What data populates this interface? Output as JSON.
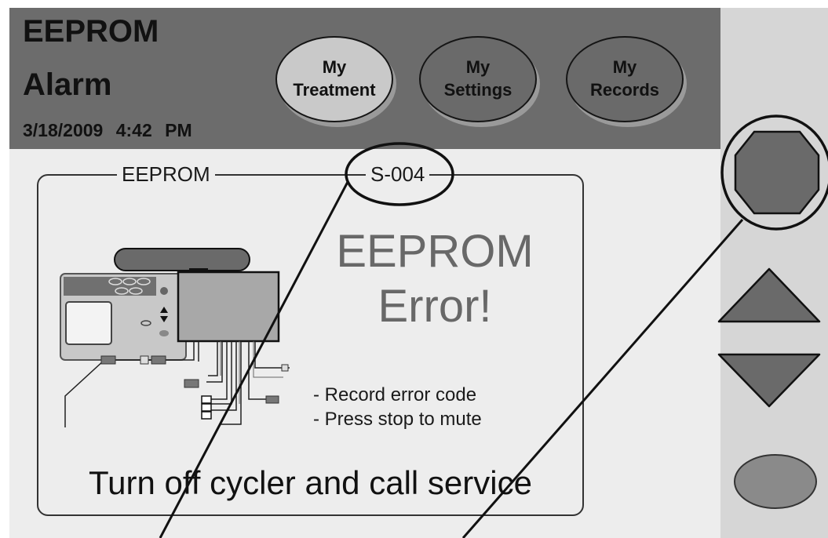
{
  "header": {
    "title_line_1": "EEPROM",
    "title_line_2": "Alarm",
    "date": "3/18/2009",
    "time": "4:42 PM"
  },
  "nav": {
    "treatment": "My\nTreatment",
    "settings": "My\nSettings",
    "records": "My\nRecords",
    "selected": "treatment"
  },
  "alarm": {
    "legend_left": "EEPROM",
    "legend_right": "S-004",
    "heading_line_1": "EEPROM",
    "heading_line_2": "Error!",
    "instruction_1": "- Record error code",
    "instruction_2": "- Press stop to mute",
    "footer": "Turn off cycler and call service"
  },
  "side_buttons": {
    "stop_icon": "octagon-stop-icon",
    "up_icon": "triangle-up-icon",
    "down_icon": "triangle-down-icon",
    "enter_icon": "oval-enter-icon"
  },
  "colors": {
    "header_bg": "#6c6c6c",
    "screen_bg": "#ededed",
    "side_bg": "#d6d6d6",
    "selected_tab": "#c9c9c9"
  }
}
